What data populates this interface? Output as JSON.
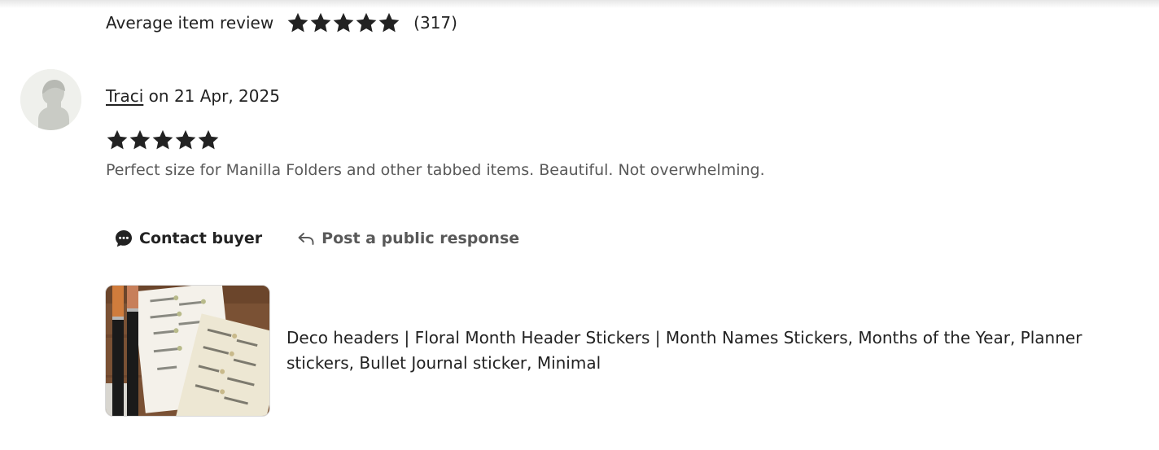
{
  "average": {
    "label": "Average item review",
    "stars": 5,
    "count": "(317)"
  },
  "review": {
    "reviewer_name": "Traci",
    "date_text": " on 21 Apr, 2025",
    "rating": 5,
    "text": "Perfect size for Manilla Folders and other tabbed items. Beautiful. Not overwhelming."
  },
  "actions": {
    "contact_label": "Contact buyer",
    "post_label": "Post a public response"
  },
  "product": {
    "title": "Deco headers | Floral Month Header Stickers | Month Names Stickers, Months of the Year, Planner stickers, Bullet Journal sticker, Minimal",
    "thumb_icon": "sticker-sheet-photo"
  },
  "colors": {
    "star": "#222222",
    "text": "#222222",
    "muted_text": "#595959",
    "avatar_bg": "#eff0ec"
  }
}
